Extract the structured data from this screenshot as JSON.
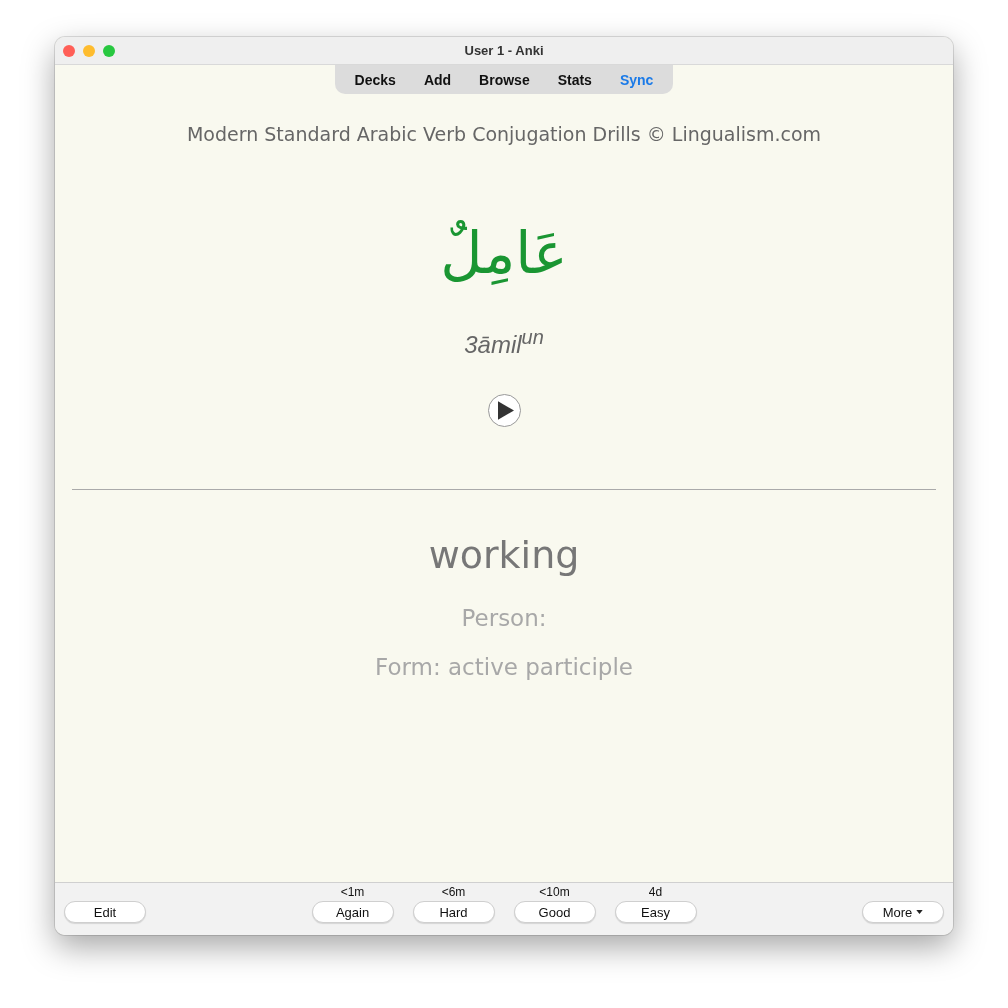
{
  "window": {
    "title": "User 1 - Anki"
  },
  "toolbar": {
    "items": [
      {
        "label": "Decks",
        "highlighted": false
      },
      {
        "label": "Add",
        "highlighted": false
      },
      {
        "label": "Browse",
        "highlighted": false
      },
      {
        "label": "Stats",
        "highlighted": false
      },
      {
        "label": "Sync",
        "highlighted": true
      }
    ]
  },
  "card": {
    "header": "Modern Standard Arabic Verb Conjugation Drills © Lingualism.com",
    "word": "عَامِلٌ",
    "transliteration": "3āmil$^{un}$",
    "meaning": "working",
    "fields": [
      "Person:",
      "Form: active participle"
    ]
  },
  "bottom_bar": {
    "edit_button": "Edit",
    "answers": [
      {
        "interval": "<1m",
        "label": "Again"
      },
      {
        "interval": "<6m",
        "label": "Hard"
      },
      {
        "interval": "<10m",
        "label": "Good"
      },
      {
        "interval": "4d",
        "label": "Easy"
      }
    ],
    "more_button": "More"
  }
}
